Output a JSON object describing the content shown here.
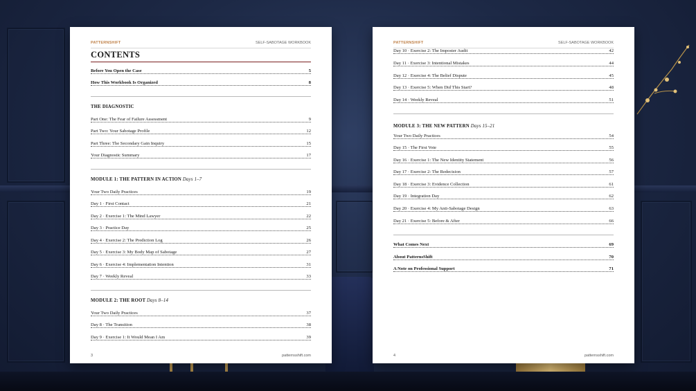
{
  "header": {
    "brand": "PATTERNSHIFT",
    "workbook": "SELF-SABOTAGE WORKBOOK"
  },
  "footer_site": "patternsshift.com",
  "left_page": {
    "number": "3",
    "title": "CONTENTS",
    "intro": [
      {
        "label": "Before You Open the Case",
        "page": "5"
      },
      {
        "label": "How This Workbook Is Organized",
        "page": "8"
      }
    ],
    "diagnostic": {
      "heading": "THE DIAGNOSTIC",
      "items": [
        {
          "label": "Part One: The Fear of Failure Assessment",
          "page": "9"
        },
        {
          "label": "Part Two: Your Sabotage Profile",
          "page": "12"
        },
        {
          "label": "Part Three: The Secondary Gain Inquiry",
          "page": "15"
        },
        {
          "label": "Your Diagnostic Summary",
          "page": "17"
        }
      ]
    },
    "module1": {
      "heading": "MODULE 1: THE PATTERN IN ACTION",
      "days": "Days 1–7",
      "items": [
        {
          "label": "Your Two Daily Practices",
          "page": "19"
        },
        {
          "label": "Day 1 · First Contact",
          "page": "21"
        },
        {
          "label": "Day 2 · Exercise 1: The Mind Lawyer",
          "page": "22"
        },
        {
          "label": "Day 3 · Practice Day",
          "page": "25"
        },
        {
          "label": "Day 4 · Exercise 2: The Prediction Log",
          "page": "26"
        },
        {
          "label": "Day 5 · Exercise 3: My Body Map of Sabotage",
          "page": "27"
        },
        {
          "label": "Day 6 · Exercise 4: Implementation Intention",
          "page": "31"
        },
        {
          "label": "Day 7 · Weekly Reveal",
          "page": "33"
        }
      ]
    },
    "module2": {
      "heading": "MODULE 2: THE ROOT",
      "days": "Days 8–14",
      "items": [
        {
          "label": "Your Two Daily Practices",
          "page": "37"
        },
        {
          "label": "Day 8 · The Transition",
          "page": "38"
        },
        {
          "label": "Day 9 · Exercise 1: It Would Mean I Am",
          "page": "39"
        }
      ]
    }
  },
  "right_page": {
    "number": "4",
    "module2_cont": [
      {
        "label": "Day 10 · Exercise 2: The Imposter Audit",
        "page": "42"
      },
      {
        "label": "Day 11 · Exercise 3: Intentional Mistakes",
        "page": "44"
      },
      {
        "label": "Day 12 · Exercise 4: The Belief Dispute",
        "page": "45"
      },
      {
        "label": "Day 13 · Exercise 5: When Did This Start?",
        "page": "48"
      },
      {
        "label": "Day 14 · Weekly Reveal",
        "page": "51"
      }
    ],
    "module3": {
      "heading": "MODULE 3: THE NEW PATTERN",
      "days": "Days 15–21",
      "items": [
        {
          "label": "Your Two Daily Practices",
          "page": "54"
        },
        {
          "label": "Day 15 · The First Vote",
          "page": "55"
        },
        {
          "label": "Day 16 · Exercise 1: The New Identity Statement",
          "page": "56"
        },
        {
          "label": "Day 17 · Exercise 2: The Redecision",
          "page": "57"
        },
        {
          "label": "Day 18 · Exercise 3: Evidence Collection",
          "page": "61"
        },
        {
          "label": "Day 19 · Integration Day",
          "page": "62"
        },
        {
          "label": "Day 20 · Exercise 4: My Anti-Sabotage Design",
          "page": "63"
        },
        {
          "label": "Day 21 · Exercise 5: Before & After",
          "page": "66"
        }
      ]
    },
    "closing": [
      {
        "label": "What Comes Next",
        "page": "69"
      },
      {
        "label": "About PatternsShift",
        "page": "70"
      },
      {
        "label": "A Note on Professional Support",
        "page": "71"
      }
    ]
  }
}
